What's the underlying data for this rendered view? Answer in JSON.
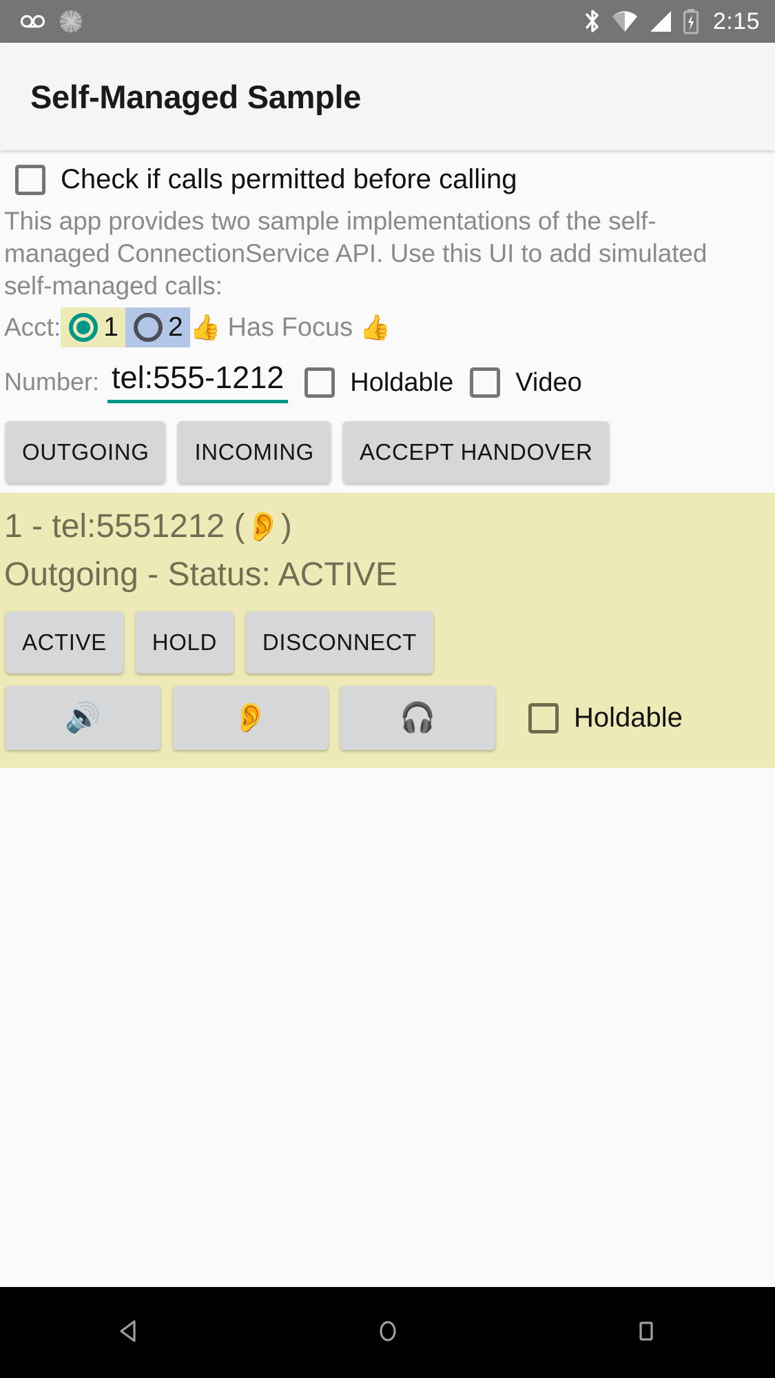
{
  "status_bar": {
    "icons_left": [
      "voicemail-icon",
      "sync-spinner-icon"
    ],
    "icons_right": [
      "bluetooth-icon",
      "wifi-icon",
      "cell-signal-icon",
      "battery-charging-icon"
    ],
    "time": "2:15",
    "background_color": "#757575"
  },
  "app_bar": {
    "title": "Self-Managed Sample",
    "background_color": "#f5f5f5"
  },
  "permit_check": {
    "label": "Check if calls permitted before calling",
    "checked": false
  },
  "description": "This app provides two sample implementations of the self-managed ConnectionService API.  Use this UI to add simulated self-managed calls:",
  "account": {
    "label": "Acct:",
    "options": [
      {
        "num": "1",
        "selected": true,
        "chip_color": "#eeeab8"
      },
      {
        "num": "2",
        "selected": false,
        "chip_color": "#b3c6e7"
      }
    ],
    "focus_emoji_left": "👍",
    "focus_text": "Has Focus",
    "focus_emoji_right": "👍",
    "selected_color": "#009688"
  },
  "number_row": {
    "label": "Number:",
    "value": "tel:555-1212",
    "placeholder": "tel:555-1212",
    "underline_color": "#009688",
    "holdable_label": "Holdable",
    "holdable_checked": false,
    "video_label": "Video",
    "video_checked": false
  },
  "action_buttons": [
    {
      "label": "OUTGOING"
    },
    {
      "label": "INCOMING"
    },
    {
      "label": "ACCEPT HANDOVER"
    }
  ],
  "call_card": {
    "background_color": "#eeeab8",
    "text_color": "#6f6f54",
    "line1_prefix": "1 - tel:5551212 (",
    "line1_emoji": "👂",
    "line1_suffix": ")",
    "line2": "Outgoing - Status: ACTIVE",
    "state_buttons": [
      {
        "label": "ACTIVE"
      },
      {
        "label": "HOLD"
      },
      {
        "label": "DISCONNECT"
      }
    ],
    "audio_buttons": [
      {
        "icon": "speaker-icon",
        "emoji": "🔊"
      },
      {
        "icon": "earpiece-icon",
        "emoji": "👂"
      },
      {
        "icon": "headset-icon",
        "emoji": "🎧"
      }
    ],
    "holdable_label": "Holdable",
    "holdable_checked": false
  },
  "nav_bar": {
    "background_color": "#000000",
    "buttons": [
      "back-icon",
      "home-icon",
      "recents-icon"
    ]
  }
}
